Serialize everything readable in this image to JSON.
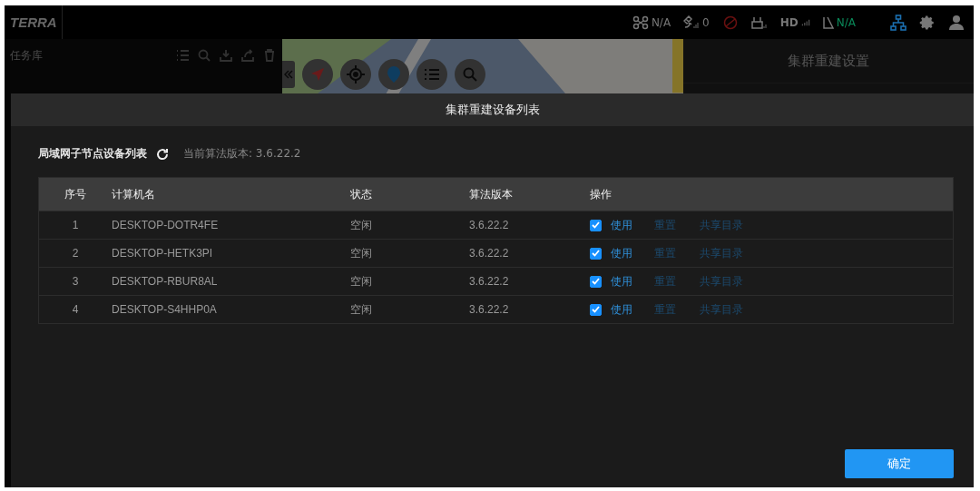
{
  "top_bar": {
    "logo": "TERRA",
    "status": [
      {
        "kind": "drone",
        "text": "N/A"
      },
      {
        "kind": "satellite",
        "text": "0"
      },
      {
        "kind": "blocked"
      },
      {
        "kind": "remote"
      },
      {
        "kind": "hd",
        "text": "HD"
      },
      {
        "kind": "rtk",
        "text": "N/A"
      }
    ]
  },
  "sidebar": {
    "title": "任务库"
  },
  "right_panel": {
    "title": "集群重建设置"
  },
  "modal": {
    "title": "集群重建设备列表",
    "section_title": "局域网子节点设备列表",
    "version": "当前算法版本: 3.6.22.2",
    "columns": [
      "序号",
      "计算机名",
      "状态",
      "算法版本",
      "操作"
    ],
    "rows": [
      {
        "index": "1",
        "name": "DESKTOP-DOTR4FE",
        "status": "空闲",
        "version": "3.6.22.2",
        "use": {
          "label": "使用",
          "checked": true
        },
        "reset": "重置",
        "share": "共享目录"
      },
      {
        "index": "2",
        "name": "DESKTOP-HETK3PI",
        "status": "空闲",
        "version": "3.6.22.2",
        "use": {
          "label": "使用",
          "checked": true
        },
        "reset": "重置",
        "share": "共享目录"
      },
      {
        "index": "3",
        "name": "DESKTOP-RBUR8AL",
        "status": "空闲",
        "version": "3.6.22.2",
        "use": {
          "label": "使用",
          "checked": true
        },
        "reset": "重置",
        "share": "共享目录"
      },
      {
        "index": "4",
        "name": "DESKTOP-S4HHP0A",
        "status": "空闲",
        "version": "3.6.22.2",
        "use": {
          "label": "使用",
          "checked": true
        },
        "reset": "重置",
        "share": "共享目录"
      }
    ],
    "confirm": "确定"
  }
}
